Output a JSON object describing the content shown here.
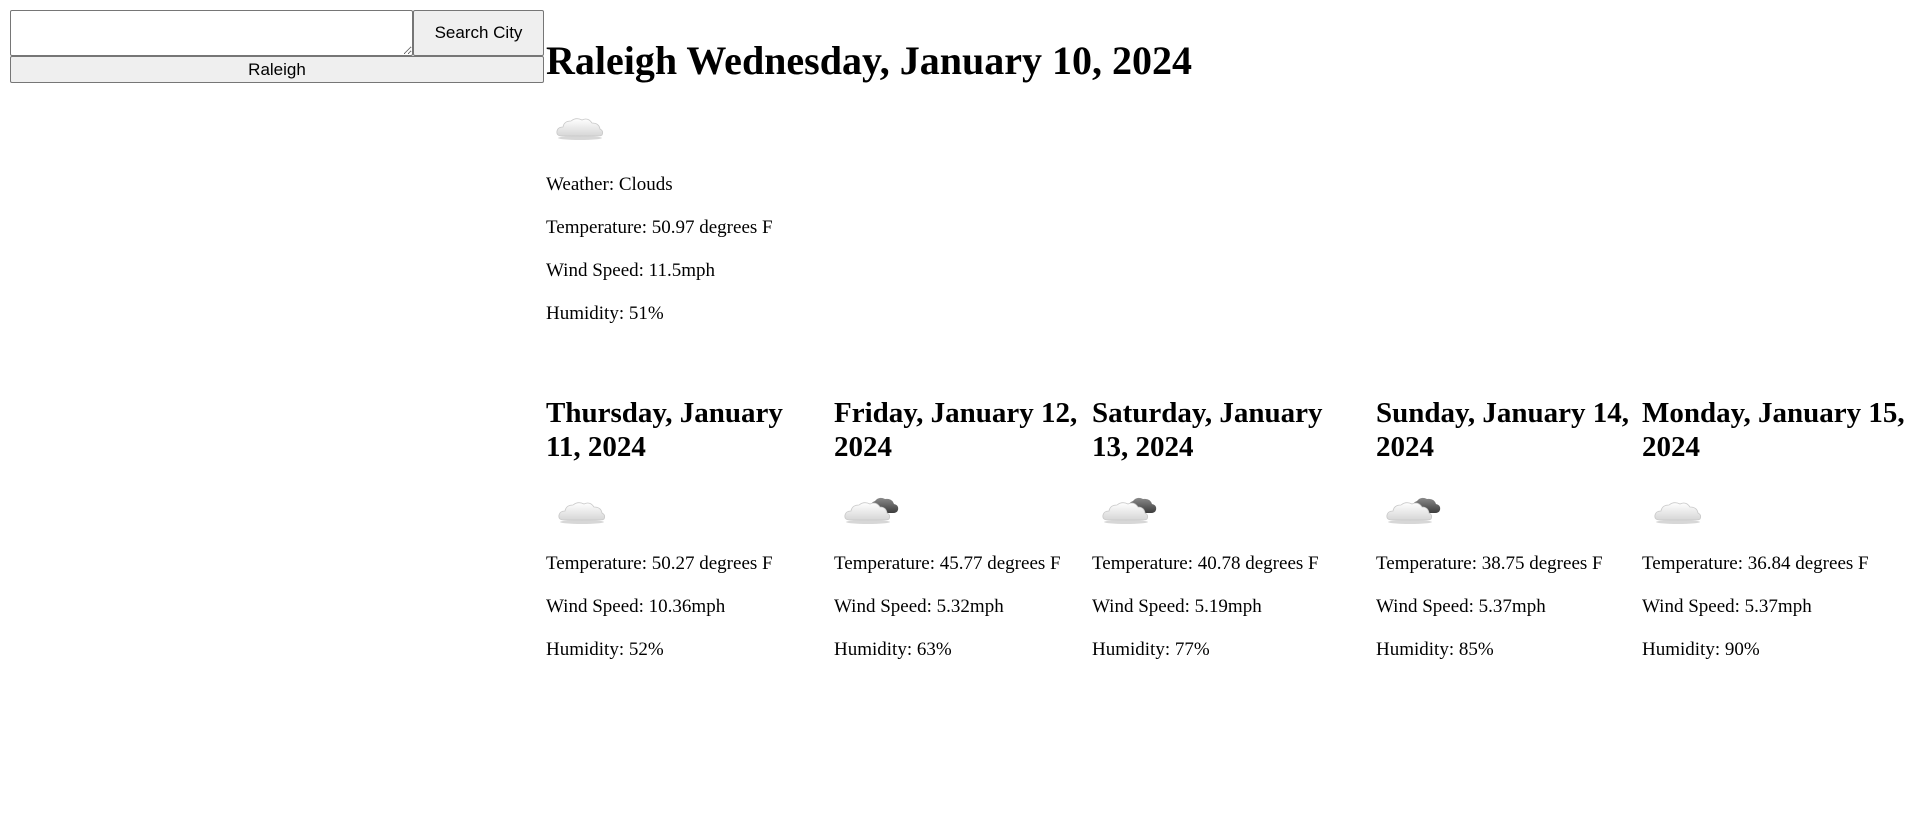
{
  "search": {
    "input_value": "",
    "button_label": "Search City",
    "history": [
      "Raleigh"
    ]
  },
  "current": {
    "title": "Raleigh Wednesday, January 10, 2024",
    "icon": "clouds-icon",
    "weather": "Weather: Clouds",
    "temperature": "Temperature: 50.97 degrees F",
    "wind": "Wind Speed: 11.5mph",
    "humidity": "Humidity: 51%"
  },
  "forecast": [
    {
      "date": "Thursday, January 11, 2024",
      "icon": "clouds-icon",
      "temperature": "Temperature: 50.27 degrees F",
      "wind": "Wind Speed: 10.36mph",
      "humidity": "Humidity: 52%"
    },
    {
      "date": "Friday, January 12, 2024",
      "icon": "broken-clouds-icon",
      "temperature": "Temperature: 45.77 degrees F",
      "wind": "Wind Speed: 5.32mph",
      "humidity": "Humidity: 63%"
    },
    {
      "date": "Saturday, January 13, 2024",
      "icon": "broken-clouds-icon",
      "temperature": "Temperature: 40.78 degrees F",
      "wind": "Wind Speed: 5.19mph",
      "humidity": "Humidity: 77%"
    },
    {
      "date": "Sunday, January 14, 2024",
      "icon": "broken-clouds-icon",
      "temperature": "Temperature: 38.75 degrees F",
      "wind": "Wind Speed: 5.37mph",
      "humidity": "Humidity: 85%"
    },
    {
      "date": "Monday, January 15, 2024",
      "icon": "clouds-icon",
      "temperature": "Temperature: 36.84 degrees F",
      "wind": "Wind Speed: 5.37mph",
      "humidity": "Humidity: 90%"
    }
  ]
}
